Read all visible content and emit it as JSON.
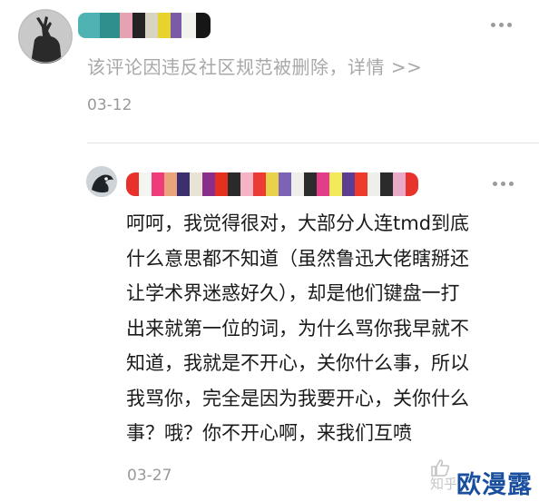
{
  "comment": {
    "deleted_notice": "该评论因违反社区规范被删除，详情 >>",
    "date": "03-12"
  },
  "reply": {
    "lines": [
      "呵呵，我觉得很对，大部分人连tmd到底",
      "什么意思都不知道（虽然鲁迅大佬瞎掰还",
      "让学术界迷惑好久），却是他们键盘一打",
      "出来就第一位的词，为什么骂你我早就不",
      "知道，我就是不开心，关你什么事，所以",
      "我骂你，完全是因为我要开心，关你什么",
      "事？哦？你不开心啊，来我们互喷"
    ],
    "date": "03-27"
  },
  "watermark": {
    "platform": "知乎",
    "logo_text": "欧漫露"
  },
  "icons": {
    "more": "more-dots-icon",
    "like": "thumbs-up-icon"
  },
  "colors": {
    "deleted_text": "#a8a8a8",
    "date_text": "#999999",
    "logo": "#1a4fa0"
  }
}
